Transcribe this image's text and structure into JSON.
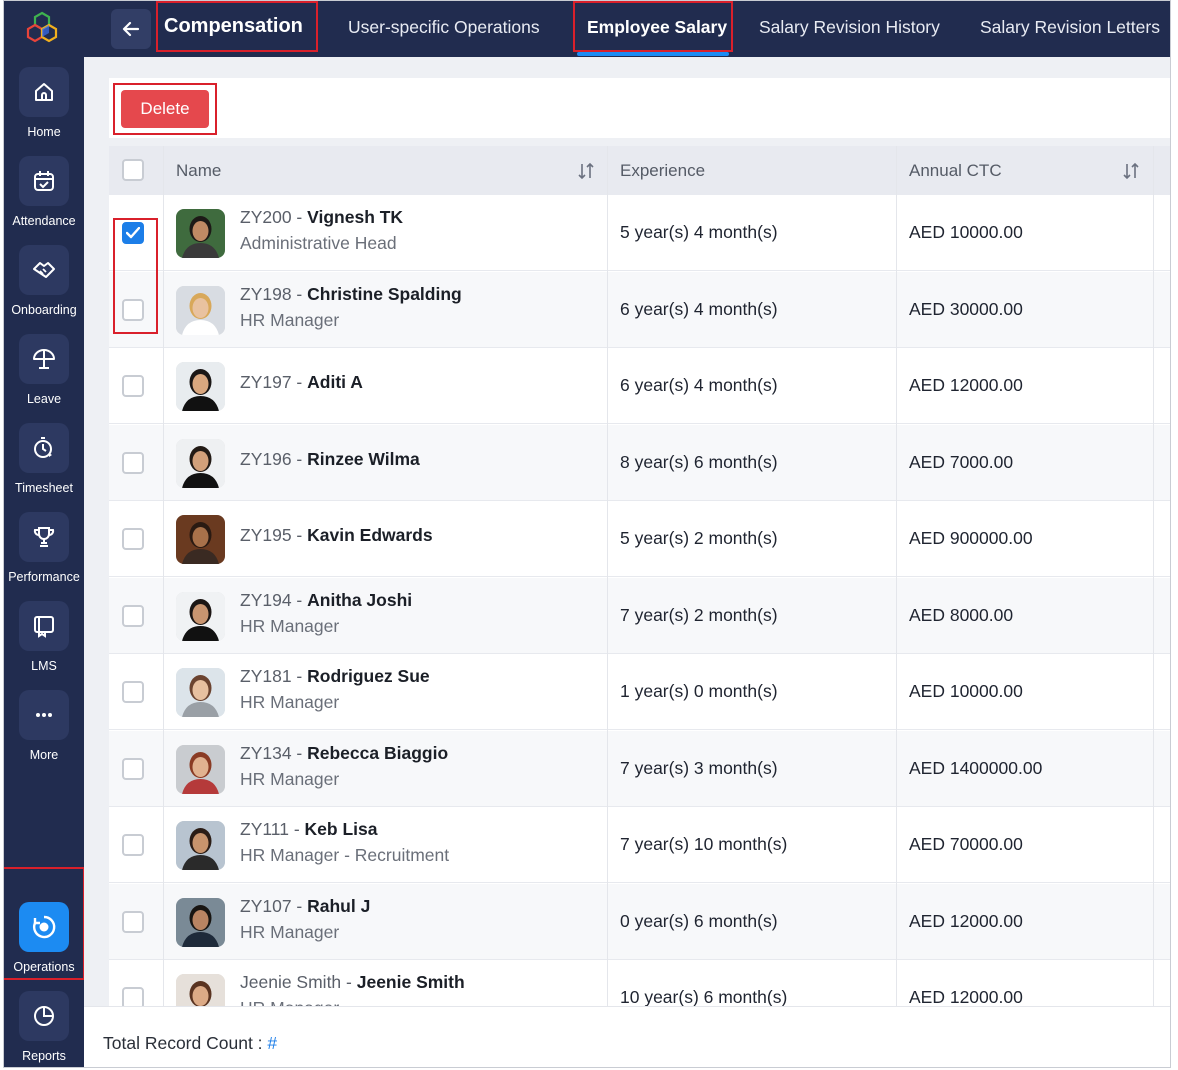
{
  "sidebar": {
    "items": [
      {
        "label": "Home",
        "icon": "home-icon"
      },
      {
        "label": "Attendance",
        "icon": "calendar-check-icon"
      },
      {
        "label": "Onboarding",
        "icon": "handshake-icon"
      },
      {
        "label": "Leave",
        "icon": "umbrella-icon"
      },
      {
        "label": "Timesheet",
        "icon": "timer-icon"
      },
      {
        "label": "Performance",
        "icon": "trophy-icon"
      },
      {
        "label": "LMS",
        "icon": "lms-icon"
      },
      {
        "label": "More",
        "icon": "more-dots-icon"
      },
      {
        "label": "Operations",
        "icon": "operations-icon",
        "active": true
      },
      {
        "label": "Reports",
        "icon": "pie-chart-icon"
      }
    ]
  },
  "header": {
    "title": "Compensation",
    "tabs": [
      {
        "label": "User-specific Operations"
      },
      {
        "label": "Employee Salary",
        "active": true
      },
      {
        "label": "Salary Revision History"
      },
      {
        "label": "Salary Revision Letters"
      }
    ]
  },
  "toolbar": {
    "delete_label": "Delete"
  },
  "table": {
    "columns": {
      "name": "Name",
      "experience": "Experience",
      "ctc": "Annual CTC"
    },
    "rows": [
      {
        "id": "ZY200",
        "name": "Vignesh TK",
        "role": "Administrative Head",
        "experience": "5 year(s) 4 month(s)",
        "ctc": "AED 10000.00",
        "checked": true
      },
      {
        "id": "ZY198",
        "name": "Christine Spalding",
        "role": "HR Manager",
        "experience": "6 year(s) 4 month(s)",
        "ctc": "AED 30000.00",
        "checked": false
      },
      {
        "id": "ZY197",
        "name": "Aditi A",
        "role": "",
        "experience": "6 year(s) 4 month(s)",
        "ctc": "AED 12000.00",
        "checked": false
      },
      {
        "id": "ZY196",
        "name": "Rinzee Wilma",
        "role": "",
        "experience": "8 year(s) 6 month(s)",
        "ctc": "AED 7000.00",
        "checked": false
      },
      {
        "id": "ZY195",
        "name": "Kavin Edwards",
        "role": "",
        "experience": "5 year(s) 2 month(s)",
        "ctc": "AED 900000.00",
        "checked": false
      },
      {
        "id": "ZY194",
        "name": "Anitha Joshi",
        "role": "HR Manager",
        "experience": "7 year(s) 2 month(s)",
        "ctc": "AED 8000.00",
        "checked": false
      },
      {
        "id": "ZY181",
        "name": "Rodriguez Sue",
        "role": "HR Manager",
        "experience": "1 year(s) 0 month(s)",
        "ctc": "AED 10000.00",
        "checked": false
      },
      {
        "id": "ZY134",
        "name": "Rebecca Biaggio",
        "role": "HR Manager",
        "experience": "7 year(s) 3 month(s)",
        "ctc": "AED 1400000.00",
        "checked": false
      },
      {
        "id": "ZY111",
        "name": "Keb Lisa",
        "role": "HR Manager - Recruitment",
        "experience": "7 year(s) 10 month(s)",
        "ctc": "AED 70000.00",
        "checked": false
      },
      {
        "id": "ZY107",
        "name": "Rahul J",
        "role": "HR Manager",
        "experience": "0 year(s) 6 month(s)",
        "ctc": "AED 12000.00",
        "checked": false
      },
      {
        "id": "Jeenie Smith",
        "name": "Jeenie Smith",
        "role": "HR Manager",
        "experience": "10 year(s) 6 month(s)",
        "ctc": "AED 12000.00",
        "checked": false
      }
    ]
  },
  "footer": {
    "label": "Total Record Count :",
    "count": "#"
  },
  "colors": {
    "sidebar_bg": "#212c4f",
    "accent": "#1c8bf2",
    "delete": "#e5484d",
    "highlight": "#d9202b"
  }
}
